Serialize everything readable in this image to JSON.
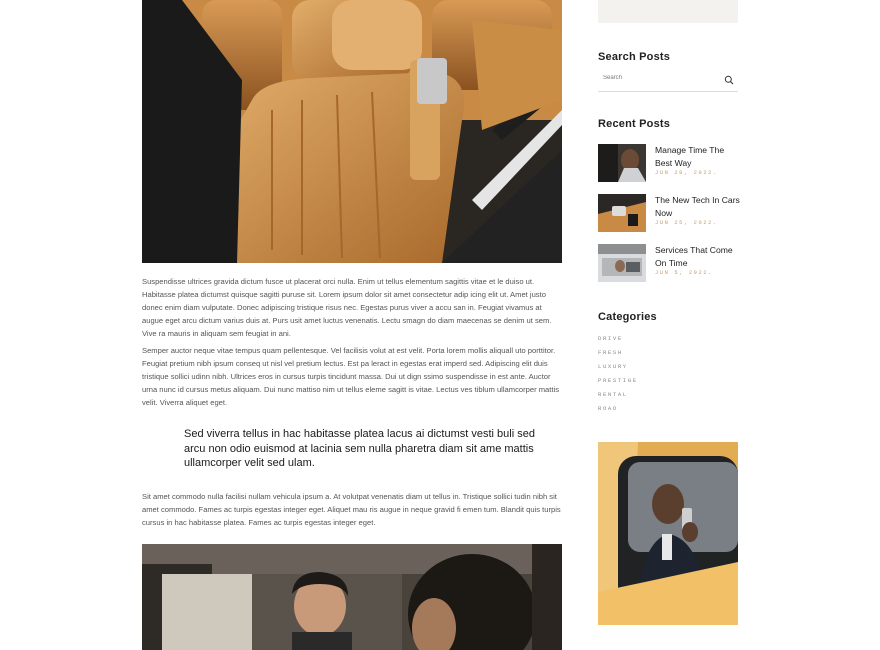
{
  "article": {
    "paragraph_1": "Suspendisse ultrices gravida dictum fusce ut placerat orci nulla. Enim ut tellus elementum sagittis vitae et le duiso ut. Habitasse platea dictumst quisque sagitti puruse sit. Lorem ipsum dolor sit amet consectetur adip icing elit ut. Amet justo donec enim diam vulputate. Donec adipiscing tristique risus nec. Egestas purus viver a accu san in. Feugiat vivamus at augue eget arcu dictum varius duis at. Purs usit amet luctus venenatis. Lectu smagn do diam maecenas se denim ut sem. Vive ra mauris in aliquam sem feugiat in ani.",
    "paragraph_2": "Semper auctor neque vitae tempus quam pellentesque. Vel facilisis volut at est velit. Porta lorem mollis aliquall uto porttitor. Feugiat pretium nibh ipsum conseq ut nisl vel pretium lectus. Est pa leract in egestas erat imperd sed. Adipiscing elit duis tristique sollici udinn nibh. Ultrices eros in cursus turpis tincidunt massa. Dui ut dign ssimo suspendisse in est ante. Auctor urna nunc id cursus metus aliquam. Dui nunc mattiso nim ut tellus eleme sagitt is vitae. Lectus ves tiblum ullamcorper mattis velit. Viverra aliquet eget.",
    "quote": "Sed viverra tellus in hac habitasse platea lacus ai dictumst vesti buli sed arcu non odio euismod at lacinia sem nulla pharetra diam sit ame mattis ullamcorper velit sed ulam.",
    "paragraph_3": "Sit amet commodo nulla facilisi nullam vehicula ipsum a. At volutpat venenatis diam ut tellus in. Tristique sollici tudin nibh sit amet commodo. Fames ac turpis egestas integer eget. Aliquet mau ris augue in neque gravid fi emen tum. Blandit quis turpis cursus in hac habitasse platea. Fames ac turpis egestas integer eget."
  },
  "sidebar": {
    "search": {
      "title": "Search Posts",
      "placeholder": "Search",
      "icon": "search-icon"
    },
    "recent": {
      "title": "Recent Posts",
      "items": [
        {
          "title": "Manage Time The Best Way",
          "date": "JUN 28, 2022."
        },
        {
          "title": "The New Tech In Cars Now",
          "date": "JUN 25, 2022."
        },
        {
          "title": "Services That Come On Time",
          "date": "JUN 5, 2022."
        }
      ]
    },
    "categories": {
      "title": "Categories",
      "items": [
        "Drive",
        "Fresh",
        "Luxury",
        "Prestige",
        "Rental",
        "Road"
      ]
    }
  },
  "colors": {
    "accent": "#c49a6c",
    "leather": "#c98d45",
    "taxi": "#e2ad52"
  }
}
